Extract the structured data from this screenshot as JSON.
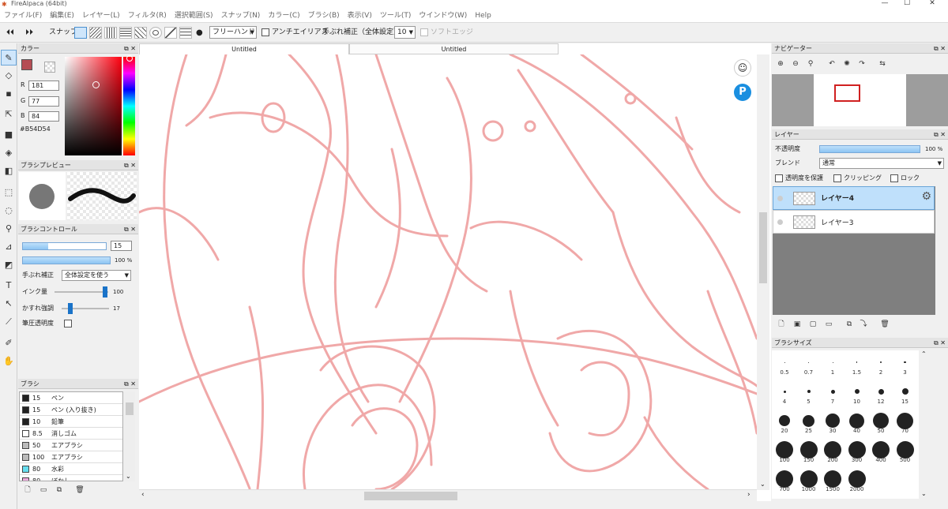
{
  "app": {
    "title": "FireAlpaca (64bit)"
  },
  "window_controls": {
    "minimize": "—",
    "maximize": "☐",
    "close": "✕"
  },
  "menu": [
    "ファイル(F)",
    "編集(E)",
    "レイヤー(L)",
    "フィルタ(R)",
    "選択範囲(S)",
    "スナップ(N)",
    "カラー(C)",
    "ブラシ(B)",
    "表示(V)",
    "ツール(T)",
    "ウインドウ(W)",
    "Help"
  ],
  "toolbar": {
    "snap_label": "スナップ",
    "mode_value": "フリーハンド",
    "antialias_label": "アンチエイリアス",
    "stabilizer_label": "手ぶれ補正（全体設定）",
    "stabilizer_value": "10",
    "soft_edge_label": "ソフトエッジ"
  },
  "tabs": [
    "Untitled",
    "Untitled"
  ],
  "color_panel": {
    "title": "カラー",
    "r_label": "R",
    "r_value": "181",
    "g_label": "G",
    "g_value": "77",
    "b_label": "B",
    "b_value": "84",
    "hex": "#B54D54",
    "primary_color": "#B54D54"
  },
  "brush_preview": {
    "title": "ブラシプレビュー"
  },
  "brush_control": {
    "title": "ブラシコントロール",
    "size_value": "15",
    "opacity_value": "100 %",
    "opacity_fraction": 1.0,
    "size_fraction": 0.3,
    "stabilizer_label": "手ぶれ補正",
    "stabilizer_value": "全体設定を使う",
    "ink_label": "インク量",
    "ink_value": "100",
    "blur_label": "かすれ強調",
    "blur_value": "17",
    "pressure_label": "筆圧透明度"
  },
  "brush_panel": {
    "title": "ブラシ",
    "items": [
      {
        "size": "15",
        "name": "ペン",
        "color": "#222222"
      },
      {
        "size": "15",
        "name": "ペン (入り抜き)",
        "color": "#222222"
      },
      {
        "size": "10",
        "name": "鉛筆",
        "color": "#222222"
      },
      {
        "size": "8.5",
        "name": "消しゴム",
        "color": "#ffffff"
      },
      {
        "size": "50",
        "name": "エアブラシ",
        "color": "#bbbbbb"
      },
      {
        "size": "100",
        "name": "エアブラシ",
        "color": "#bbbbbb"
      },
      {
        "size": "80",
        "name": "水彩",
        "color": "#66ddee"
      },
      {
        "size": "80",
        "name": "ぼかし",
        "color": "#eeaadd"
      }
    ]
  },
  "navigator": {
    "title": "ナビゲーター"
  },
  "layer_panel": {
    "title": "レイヤー",
    "opacity_label": "不透明度",
    "opacity_value": "100 %",
    "opacity_fraction": 1.0,
    "blend_label": "ブレンド",
    "blend_value": "通常",
    "protect_label": "透明度を保護",
    "clipping_label": "クリッピング",
    "lock_label": "ロック",
    "layers": [
      {
        "name": "レイヤー4",
        "selected": true
      },
      {
        "name": "レイヤー3",
        "selected": false
      }
    ]
  },
  "brush_size_panel": {
    "title": "ブラシサイズ",
    "sizes": [
      "0.5",
      "0.7",
      "1",
      "1.5",
      "2",
      "3",
      "4",
      "5",
      "7",
      "10",
      "12",
      "15",
      "20",
      "25",
      "30",
      "40",
      "50",
      "70",
      "100",
      "150",
      "200",
      "300",
      "400",
      "500",
      "700",
      "1000",
      "1500",
      "2000"
    ]
  },
  "tools": [
    "pen-icon",
    "eraser-icon",
    "dot-icon",
    "move-icon",
    "fill-rect-icon",
    "bucket-icon",
    "gradient-icon",
    "select-icon",
    "lasso-icon",
    "magic-wand-icon",
    "select-pen-icon",
    "select-eraser-icon",
    "text-icon",
    "operation-icon",
    "divide-icon",
    "eyedropper-icon",
    "hand-icon"
  ],
  "accent": "#4a90d0",
  "sketch_color": "#f0a8a8"
}
